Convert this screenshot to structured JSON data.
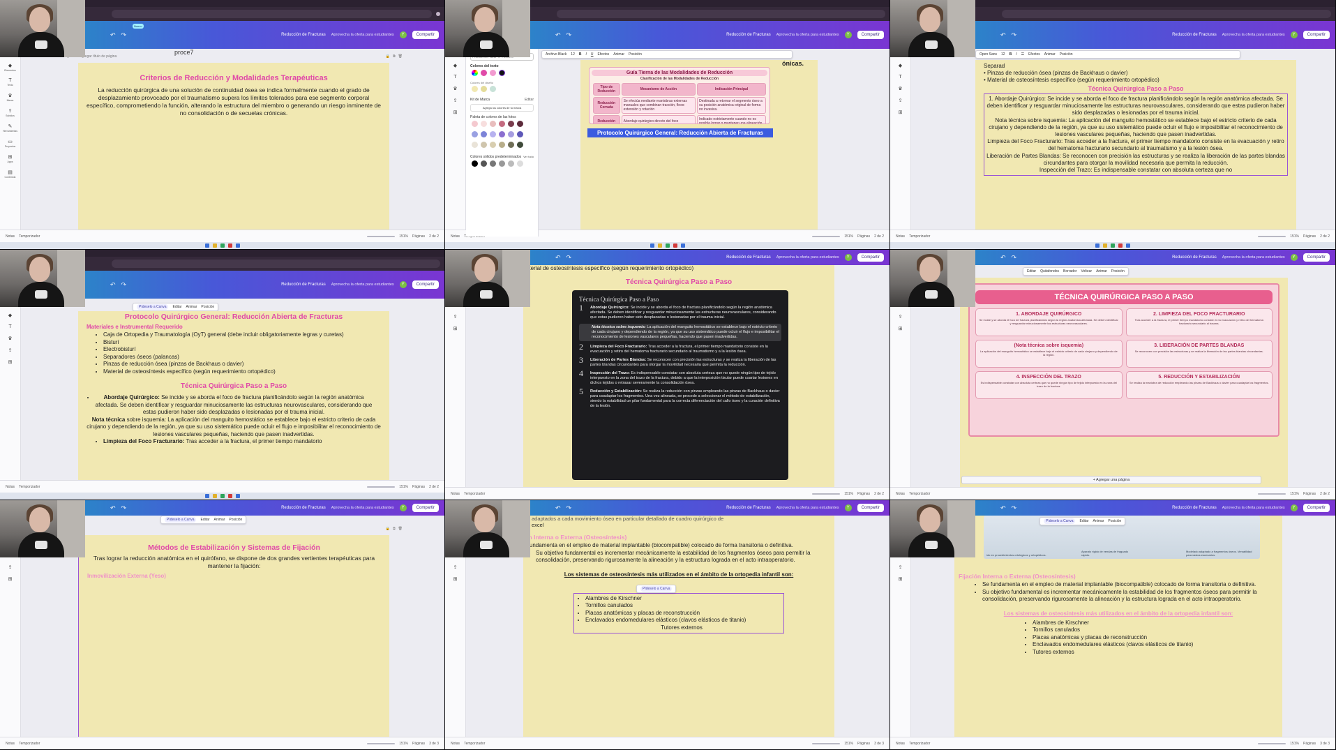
{
  "app": {
    "doc_title": "Reducción de Fracturas",
    "promo": "Aprovecha la oferta para estudiantes",
    "share": "Compartir",
    "badge": "Nuevo",
    "avatar": "Y"
  },
  "sidebar": [
    "Elementos",
    "Texto",
    "Marca",
    "Subidos",
    "Herramientas",
    "Proyectos",
    "Apps",
    "Contenido"
  ],
  "status": {
    "notes": "Notas",
    "timer": "Temporizador",
    "zoom": "151%",
    "pages_label": "Páginas",
    "pages_tiles": [
      "2 de 2",
      "2 de 2",
      "2 de 2",
      "2 de 2",
      "2 de 2",
      "2 de 2",
      "3 de 3",
      "3 de 3",
      "3 de 3"
    ]
  },
  "tiles": {
    "t1": {
      "page_label": "Página 2 - Agregar título de página",
      "caption": "proce7",
      "title": "Criterios de Reducción y Modalidades Terapéuticas",
      "body": "La reducción quirúrgica de una solución de continuidad ósea se indica formalmente cuando el grado de desplazamiento provocado por el traumatismo supera los límites tolerados para ese segmento corporal específico, comprometiendo la función, alterando la estructura del miembro o generando un riesgo inminente de no consolidación o de secuelas crónicas."
    },
    "t2": {
      "search": "Prueba con \"azul\" o \"#00c4cc\"",
      "doc_colors": "Colores del texto",
      "doc_colors2": "Colores del diseño",
      "brand": "Kit de Marca",
      "brand_edit": "Editar",
      "add_brand": "Agrega los colores de tu marca",
      "photo_colors": "Paleta de colores de las fotos",
      "solid": "Colores sólidos predeterminados",
      "see_all": "Ver todo",
      "font": "Archivo Black",
      "size": "12",
      "effects": "Efectos",
      "animate": "Animar",
      "position": "Posición",
      "heading_text": "ónicas.",
      "guide_title": "Guía Tierna de las Modalidades de Reducción",
      "guide_sub": "Clasificación de las Modalidades de Reducción",
      "cols": [
        "Tipo de Reducción",
        "Mecanismo de Acción",
        "Indicación Principal"
      ],
      "rows": [
        [
          "Reducción Cerrada",
          "Se efectúa mediante maniobras externas manuales que combinan tracción, flexo-extensión y rotación",
          "Destinada a retornar el segmento óseo a su posición anatómica original de forma no invasiva."
        ],
        [
          "Reducción Abierta",
          "Abordaje quirúrgico directo del foco fracturario para remover interposiciones",
          "Indicado estrictamente cuando no es posible lograr o mantener una alineación por vía cerrada."
        ]
      ],
      "selected": "Protocolo Quirúrgico General: Reducción Abierta de Fracturas"
    },
    "t3": {
      "font": "Open Sans",
      "size": "12",
      "lines": [
        "Separad",
        "Pinzas de reducción ósea (pinzas de Backhaus o davier)",
        "Material de osteosíntesis específico (según requerimiento ortopédico)"
      ],
      "heading": "Técnica Quirúrgica Paso a Paso",
      "p1": "1. Abordaje Quirúrgico: Se incide y se aborda el foco de fractura planificándolo según la región anatómica afectada. Se deben identificar y resguardar minuciosamente las estructuras neurovasculares, considerando que estas pudieron haber sido desplazadas o lesionadas por el trauma inicial.",
      "p2": "Nota técnica sobre isquemia: La aplicación del manguito hemostático se establece bajo el estricto criterio de cada cirujano y dependiendo de la región, ya que su uso sistemático puede ocluir el flujo e imposibilitar el reconocimiento de lesiones vasculares pequeñas, haciendo que pasen inadvertidas.",
      "p3": "Limpieza del Foco Fracturario: Tras acceder a la fractura, el primer tiempo mandatorio consiste en la evacuación y retiro del hematoma fracturario secundario al traumatismo y a la lesión ósea.",
      "p4": "Liberación de Partes Blandas: Se reconocen con precisión las estructuras y se realiza la liberación de las partes blandas circundantes para otorgar la movilidad necesaria que permita la reducción.",
      "p5": "Inspección del Trazo: Es indispensable constatar con absoluta certeza que no"
    },
    "t4": {
      "title": "Protocolo Quirúrgico General: Reducción Abierta de Fracturas",
      "sub": "Materiales e Instrumental Requerido",
      "items": [
        "Caja de Ortopedia y Traumatología (OyT) general (debe incluir obligatoriamente legras y curetas)",
        "Bisturí",
        "Electrobisturí",
        "Separadores óseos (palancas)",
        "Pinzas de reducción ósea (pinzas de Backhaus o davier)",
        "Material de osteosíntesis específico (según requerimiento ortopédico)"
      ],
      "heading": "Técnica Quirúrgica Paso a Paso",
      "b1_label": "Abordaje Quirúrgico:",
      "b1": " Se incide y se aborda el foco de fractura planificándolo según la región anatómica afectada. Se deben identificar y resguardar minuciosamente las estructuras neurovasculares, considerando que estas pudieron haber sido desplazadas o lesionadas por el trauma inicial.",
      "note_label": "Nota técnica",
      "note": " sobre isquemia: La aplicación del manguito hemostático se establece bajo el estricto criterio de cada cirujano y dependiendo de la región, ya que su uso sistemático puede ocluir el flujo e imposibilitar el reconocimiento de lesiones vasculares pequeñas, haciendo que pasen inadvertidas.",
      "b2_label": "Limpieza del Foco Fracturario:",
      "b2": " Tras acceder a la fractura, el primer tiempo mandatorio"
    },
    "t5": {
      "top": "aterial de osteosíntesis específico (según requerimiento ortopédico)",
      "heading": "Técnica Quirúrgica Paso a Paso",
      "img_title": "Técnica Quirúrgica Paso a Paso",
      "steps": [
        {
          "n": "1",
          "label": "Abordaje Quirúrgico:",
          "text": " Se incide y se aborda el foco de fractura planificándolo según la región anatómica afectada. Se deben identificar y resguardar minuciosamente las estructuras neurovasculares, considerando que estas pudieron haber sido desplazadas o lesionadas por el trauma inicial."
        },
        {
          "n": "",
          "label": "Nota técnica sobre isquemia:",
          "text": " La aplicación del manguito hemostático se establece bajo el estricto criterio de cada cirujano y dependiendo de la región, ya que su uso sistemático puede ocluir el flujo e imposibilitar el reconocimiento de lesiones vasculares pequeñas, haciendo que pasen inadvertidas."
        },
        {
          "n": "2",
          "label": "Limpieza del Foco Fracturario:",
          "text": " Tras acceder a la fractura, el primer tiempo mandatorio consiste en la evacuación y retiro del hematoma fracturario secundario al traumatismo y a la lesión ósea."
        },
        {
          "n": "3",
          "label": "Liberación de Partes Blandas:",
          "text": " Se reconocen con precisión las estructuras y se realiza la liberación de las partes blandas circundantes para otorgar la movilidad necesaria que permita la reducción."
        },
        {
          "n": "4",
          "label": "Inspección del Trazo:",
          "text": " Es indispensable constatar con absoluta certeza que no quede ningún tipo de tejido interpuesto en la zona del trazo de la fractura, debido a que la interposición tisular puede coartar lesiones en dichos tejidos o retrasar severamente la consolidación ósea."
        },
        {
          "n": "5",
          "label": "Reducción y Estabilización:",
          "text": " Se realiza la reducción con pinzas empleando las pinzas de Backhaus o davier para coadaptar los fragmentos. Una vez alineada, se procede a seleccionar el método de estabilización, siendo la estabilidad un pilar fundamental para la correcta diferenciación del callo óseo y la curación definitiva de la lesión."
        }
      ]
    },
    "t6": {
      "edit": "Editar",
      "bg": "Quitafondos",
      "eraser": "Borrador",
      "trans": "Voltear",
      "anim": "Animar",
      "pos": "Posición",
      "banner": "TÉCNICA QUIRÚRGICA PASO A PASO",
      "cards": [
        {
          "t": "1. ABORDAJE QUIRÚRGICO",
          "d": "Se incide y se aborda el foco de fractura planificándolo según la región anatómica afectada. Se deben identificar y resguardar minuciosamente las estructuras neurovasculares."
        },
        {
          "t": "2. LIMPIEZA DEL FOCO FRACTURARIO",
          "d": "Tras acceder a la fractura, el primer tiempo mandatorio consiste en la evacuación y retiro del hematoma fracturario secundario al trauma."
        },
        {
          "t": "(Nota técnica sobre isquemia)",
          "d": "La aplicación del manguito hemostático se establece bajo el estricto criterio de cada cirujano y dependiendo de la región."
        },
        {
          "t": "3. LIBERACIÓN DE PARTES BLANDAS",
          "d": "Se reconocen con precisión las estructuras y se realiza la liberación de las partes blandas circundantes."
        },
        {
          "t": "4. INSPECCIÓN DEL TRAZO",
          "d": "Es indispensable constatar con absoluta certeza que no quede ningún tipo de tejido interpuesto en la zona del trazo de la fractura."
        },
        {
          "t": "5. REDUCCIÓN Y ESTABILIZACIÓN",
          "d": "Se realiza la maniobra de reducción empleando las pinzas de Backhaus o davier para coadaptar los fragmentos."
        }
      ],
      "add_page": "+ Agregar una página"
    },
    "t7": {
      "title": "Métodos de Estabilización y Sistemas de Fijación",
      "body": "Tras lograr la reducción anatómica en el quirófano, se dispone de dos grandes vertientes terapéuticas para mantener la fijación:",
      "sub": "Inmovilización Externa (Yeso)"
    },
    "t8": {
      "top": "adaptados a cada movimiento óseo en particular detallado de cuadro quirúrgico de",
      "top2": "excel",
      "sub": "ión Interna o Externa (Osteosíntesis)",
      "b1": "e fundamenta en el empleo de material implantable (biocompatible) colocado de forma transitoria o definitiva.",
      "b2": "Su objetivo fundamental es incrementar mecánicamente la estabilidad de los fragmentos óseos para permitir la consolidación, preservando rigurosamente la alineación y la estructura lograda en el acto intraoperatorio.",
      "u_title": "Los sistemas de osteosíntesis más utilizados en el ámbito de la ortopedia infantil son:",
      "items": [
        "Alambres de Kirschner",
        "Tornillos canulados",
        "Placas anatómicas y placas de reconstrucción",
        "Enclavados endomedulares elásticos (clavos elásticos de titanio)",
        "Tutores externos"
      ]
    },
    "t9": {
      "cap1": "ido en procedimientos ortológicos y ortopédicos.",
      "cap2": "Aparato rígido de vendas de fraguado rápido.",
      "cap3": "Modelado adaptado a fragmentos óseos. Versatilidad para vastos escenarios.",
      "sub": "Fijación Interna o Externa (Osteosíntesis)",
      "b1": "Se fundamenta en el empleo de material implantable (biocompatible) colocado de forma transitoria o definitiva.",
      "b2": "Su objetivo fundamental es incrementar mecánicamente la estabilidad de los fragmentos óseos para permitir la consolidación, preservando rigurosamente la alineación y la estructura lograda en el acto intraoperatorio.",
      "u_title": "Los sistemas de osteosíntesis más utilizados en el ámbito de la ortopedia infantil son:",
      "items": [
        "Alambres de Kirschner",
        "Tornillos canulados",
        "Placas anatómicas y placas de reconstrucción",
        "Enclavados endomedulares elásticos (clavos elásticos de titanio)",
        "Tutores externos"
      ]
    },
    "floatbar": {
      "magic": "Pídeselo a Canva",
      "edit": "Editar",
      "animate": "Animar",
      "position": "Posición"
    }
  },
  "colors": {
    "page": "#f1e8b2",
    "pink": "#e04aa8",
    "gradient_a": "#1a9fbf",
    "gradient_b": "#7a35d2"
  }
}
